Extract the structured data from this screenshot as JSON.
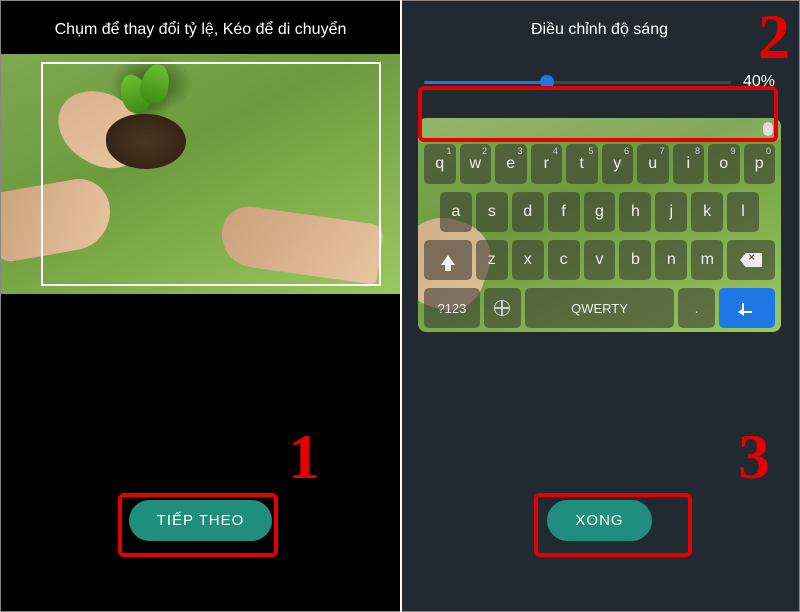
{
  "left": {
    "title": "Chụm để thay đổi tỷ lệ, Kéo để di chuyển",
    "button": "TIẾP THEO"
  },
  "right": {
    "title": "Điều chỉnh độ sáng",
    "slider": {
      "percent": 40,
      "display": "40%"
    },
    "button": "XONG"
  },
  "keyboard": {
    "row1": [
      "q",
      "w",
      "e",
      "r",
      "t",
      "y",
      "u",
      "i",
      "o",
      "p"
    ],
    "row1_sub": [
      "1",
      "2",
      "3",
      "4",
      "5",
      "6",
      "7",
      "8",
      "9",
      "0"
    ],
    "row2": [
      "a",
      "s",
      "d",
      "f",
      "g",
      "h",
      "j",
      "k",
      "l"
    ],
    "row3": [
      "z",
      "x",
      "c",
      "v",
      "b",
      "n",
      "m"
    ],
    "numbers_key": "?123",
    "layout_key": "QWERTY",
    "period_key": "."
  },
  "annotations": {
    "n1": "1",
    "n2": "2",
    "n3": "3"
  }
}
